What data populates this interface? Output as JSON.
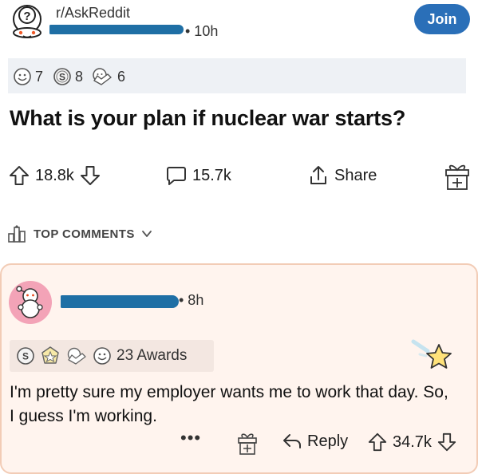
{
  "post": {
    "subreddit": "r/AskReddit",
    "time": "• 10h",
    "join_label": "Join",
    "mini_awards": [
      {
        "icon": "wholesome-award-icon",
        "count": "7"
      },
      {
        "icon": "silver-award-icon",
        "count": "8"
      },
      {
        "icon": "helpful-award-icon",
        "count": "6"
      }
    ],
    "title": "What is your plan if nuclear war starts?",
    "upvotes": "18.8k",
    "comments": "15.7k",
    "share_label": "Share"
  },
  "sort": {
    "label": "TOP COMMENTS"
  },
  "comment": {
    "time": "• 8h",
    "awards_label": "23 Awards",
    "body": "I'm pretty sure my employer wants me to work that day. So, I guess I'm working.",
    "more": "•••",
    "reply_label": "Reply",
    "upvotes": "34.7k"
  },
  "colors": {
    "accent": "#2a6fb8",
    "redaction": "#1f6fa5",
    "gilded_bg": "#fff4ee",
    "gilded_border": "#f2ccb6"
  }
}
